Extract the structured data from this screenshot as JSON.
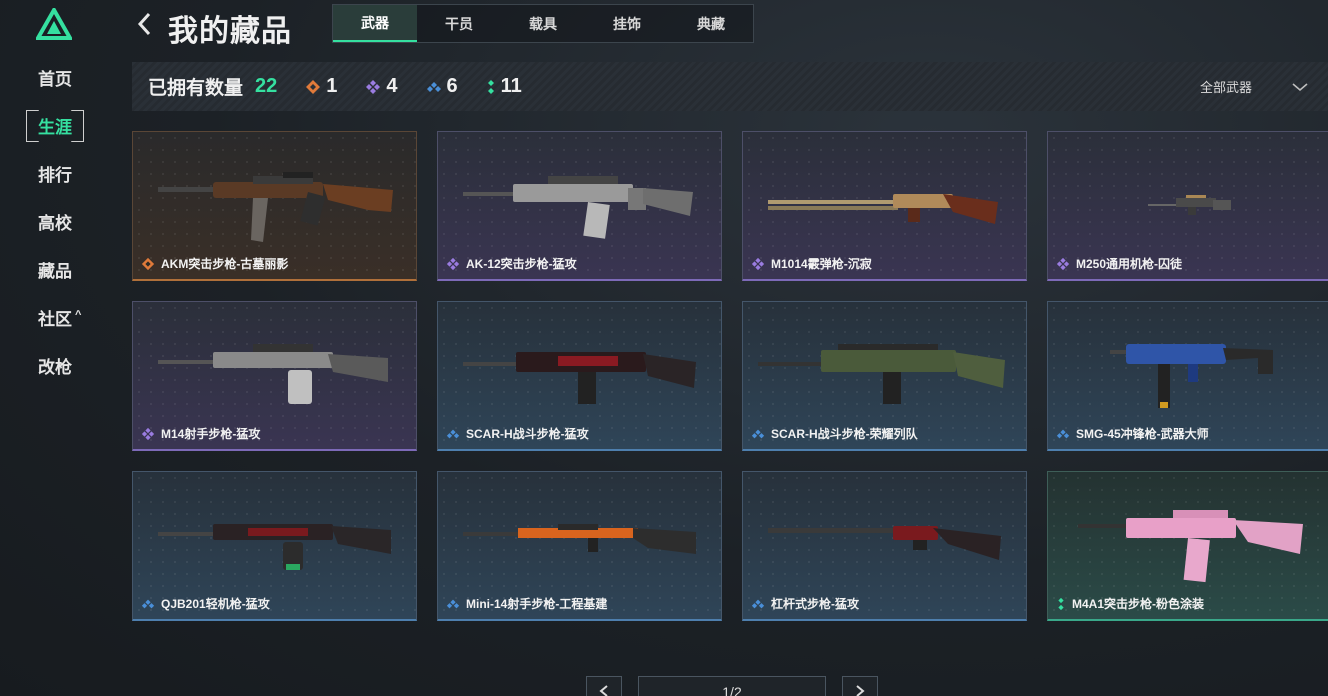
{
  "sidebar": {
    "items": [
      {
        "label": "首页"
      },
      {
        "label": "生涯"
      },
      {
        "label": "排行"
      },
      {
        "label": "高校"
      },
      {
        "label": "藏品"
      },
      {
        "label": "社区",
        "caret": "^"
      },
      {
        "label": "改枪"
      }
    ],
    "active_index": 1
  },
  "header": {
    "title": "我的藏品",
    "tabs": [
      {
        "label": "武器"
      },
      {
        "label": "干员"
      },
      {
        "label": "载具"
      },
      {
        "label": "挂饰"
      },
      {
        "label": "典藏"
      }
    ],
    "active_tab": 0
  },
  "stats": {
    "owned_label": "已拥有数量",
    "owned_count": "22",
    "rarities": [
      {
        "color": "#e07a3a",
        "icon": "orange-diamond-icon",
        "count": "1"
      },
      {
        "color": "#9a7ce0",
        "icon": "purple-diamond-icon",
        "count": "4"
      },
      {
        "color": "#4a8fd8",
        "icon": "blue-diamond-icon",
        "count": "6"
      },
      {
        "color": "#35e0a0",
        "icon": "green-dots-icon",
        "count": "11"
      }
    ],
    "filter_label": "全部武器"
  },
  "colors": {
    "accent": "#35e0a0",
    "orange": "#e07a3a",
    "purple": "#9a7ce0",
    "blue": "#4a8fd8",
    "green": "#35e0a0"
  },
  "cards": [
    {
      "name": "AKM突击步枪-古墓丽影",
      "rarity": "orange"
    },
    {
      "name": "AK-12突击步枪-猛攻",
      "rarity": "purple"
    },
    {
      "name": "M1014霰弹枪-沉寂",
      "rarity": "purple"
    },
    {
      "name": "M250通用机枪-囚徒",
      "rarity": "purple"
    },
    {
      "name": "M14射手步枪-猛攻",
      "rarity": "purple"
    },
    {
      "name": "SCAR-H战斗步枪-猛攻",
      "rarity": "blue"
    },
    {
      "name": "SCAR-H战斗步枪-荣耀列队",
      "rarity": "blue"
    },
    {
      "name": "SMG-45冲锋枪-武器大师",
      "rarity": "blue"
    },
    {
      "name": "QJB201轻机枪-猛攻",
      "rarity": "blue"
    },
    {
      "name": "Mini-14射手步枪-工程基建",
      "rarity": "blue"
    },
    {
      "name": "杠杆式步枪-猛攻",
      "rarity": "blue"
    },
    {
      "name": "M4A1突击步枪-粉色涂装",
      "rarity": "green"
    }
  ],
  "pagination": {
    "page_text": "1/2"
  }
}
